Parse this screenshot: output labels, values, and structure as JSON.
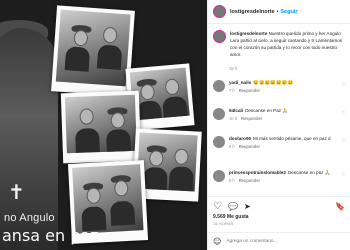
{
  "photo": {
    "cross": "✝",
    "name_partial": "no Angulo",
    "phrase": "ansa en paz"
  },
  "post": {
    "username": "lostigresdelnorte",
    "follow_label": "Seguir",
    "caption_user": "lostigresdelnorte",
    "caption_text": "Nuestro querido primo y her Angulo Lara partió al cielo, a seguir cantando y tr Lamentamos con el corazón su partida y lo recor con todo nuestro amor.",
    "caption_time": "15 h",
    "comments": [
      {
        "user": "yadi_nails",
        "text": "😢😢😢😢😢😢😢",
        "time": "7 h",
        "reply": "Responder"
      },
      {
        "user": "94lcali",
        "text": "Descanse en Paz 🙏",
        "time": "10 h",
        "reply": "Responder"
      },
      {
        "user": "doolaro06",
        "text": "Mi más sentido pésame, que en paz d",
        "time": "9 h",
        "reply": "Responder"
      },
      {
        "user": "princesspotrainslomable2",
        "text": "Descanse en paz 🙏",
        "time": "8 h",
        "reply": "Responder"
      }
    ],
    "likes": "9.569 Me gusta",
    "date": "15 HORAS",
    "comment_placeholder": "Agrega un comentario..."
  },
  "icons": {
    "heart": "♡",
    "comment": "💬",
    "share": "➤",
    "save": "🔖",
    "emoji": "☺"
  },
  "colors": {
    "follow_blue": "#0095f6",
    "muted_gray": "#8e8e8e",
    "text_dark": "#262626",
    "photo_bg": "#1d1d1d"
  }
}
